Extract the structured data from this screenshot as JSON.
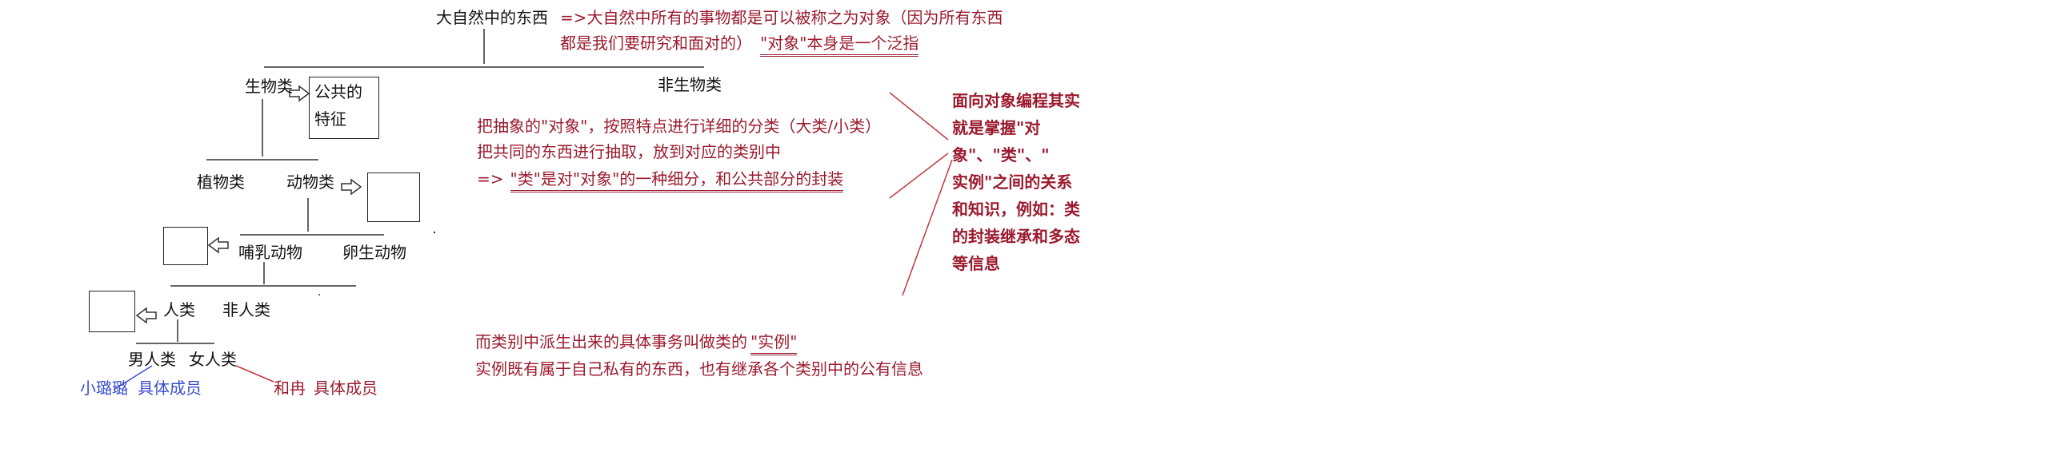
{
  "tree": {
    "root": "大自然中的东西",
    "living": "生物类",
    "nonliving": "非生物类",
    "plants": "植物类",
    "animals": "动物类",
    "mammals": "哺乳动物",
    "oviparous": "卵生动物",
    "human": "人类",
    "nonhuman": "非人类",
    "male": "男人类",
    "female": "女人类",
    "common_box_line1": "公共的",
    "common_box_line2": "特征"
  },
  "members": {
    "left_name": "小璐璐",
    "left_label": "具体成员",
    "right_name": "和冉",
    "right_label": "具体成员"
  },
  "notes": {
    "object_line1": "=>大自然中所有的事物都是可以被称之为对象（因为所有东西",
    "object_line2_prefix": "都是我们要研究和面对的）",
    "object_line2_underlined": "\"对象\"本身是一个泛指",
    "class_line1": "把抽象的\"对象\"，按照特点进行详细的分类（大类/小类）",
    "class_line2": "把共同的东西进行抽取，放到对应的类别中",
    "class_line3_prefix": "=>",
    "class_line3_underlined": "\"类\"是对\"对象\"的一种细分，和公共部分的封装",
    "instance_line1_prefix": "而类别中派生出来的具体事务叫做类的",
    "instance_line1_underlined": "\"实例\"",
    "instance_line2": "实例既有属于自己私有的东西，也有继承各个类别中的公有信息"
  },
  "summary": {
    "lines": [
      "面向对象编程其实",
      "就是掌握\"对",
      "象\"、\"类\"、\"",
      "实例\"之间的关系",
      "和知识，例如：类",
      "的封装继承和多态",
      "等信息"
    ]
  },
  "colors": {
    "black": "#111111",
    "red": "#9b1b2e",
    "blue": "#3b4fd0"
  }
}
